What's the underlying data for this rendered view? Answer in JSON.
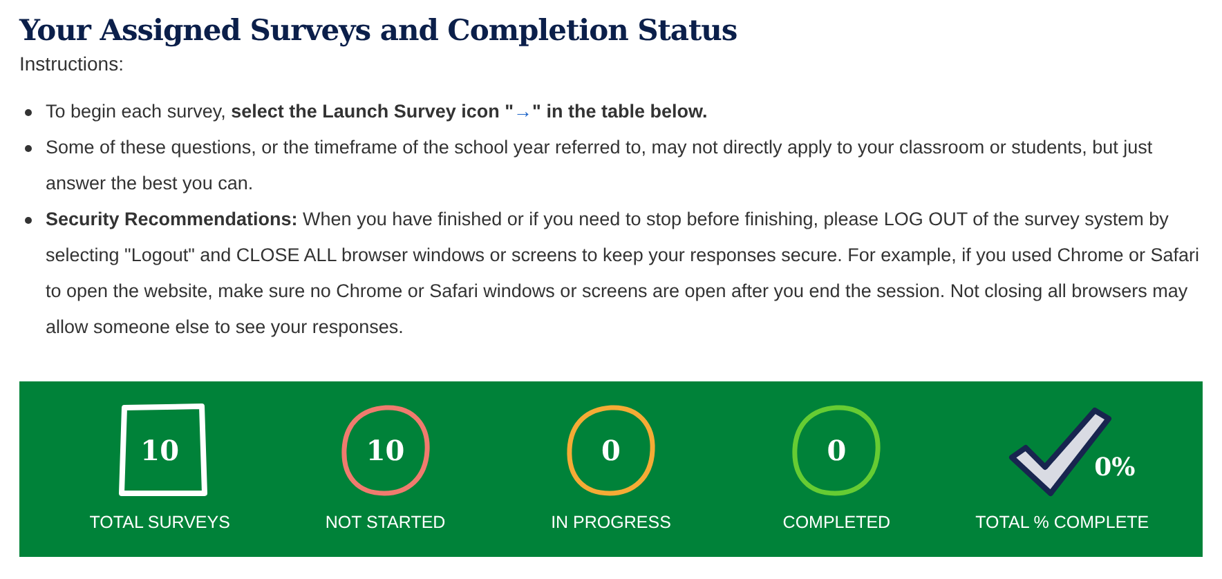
{
  "title": "Your Assigned Surveys and Completion Status",
  "instructions_label": "Instructions:",
  "bullets": [
    {
      "kind": "launch",
      "text": "To begin each survey, ",
      "bold": "select the Launch Survey icon \"",
      "icon": "→",
      "bold_after": "\" in the table below."
    },
    {
      "kind": "plain",
      "text": "Some of these questions, or the timeframe of the school year referred to, may not directly apply to your classroom or students, but just answer the best you can."
    },
    {
      "kind": "plain",
      "text": "**Security Recommendations:** When you have finished or if you need to stop before finishing, please LOG OUT of the survey system by selecting \"Logout\" and CLOSE ALL browser windows or screens to keep your responses secure. For example, if you used Chrome or Safari to open the website, make sure no Chrome or Safari windows or screens are open after you end the session. Not closing all browsers may allow someone else to see your responses."
    }
  ],
  "stats": [
    {
      "kind": "square",
      "value": "10",
      "label": "TOTAL SURVEYS",
      "color": "#ffffff"
    },
    {
      "kind": "circle",
      "value": "10",
      "label": "NOT STARTED",
      "color": "#f07b6e"
    },
    {
      "kind": "circle",
      "value": "0",
      "label": "IN PROGRESS",
      "color": "#f5ab35"
    },
    {
      "kind": "circle",
      "value": "0",
      "label": "COMPLETED",
      "color": "#66cc33"
    },
    {
      "kind": "check",
      "value": "0%",
      "label": "TOTAL % COMPLETE"
    }
  ]
}
